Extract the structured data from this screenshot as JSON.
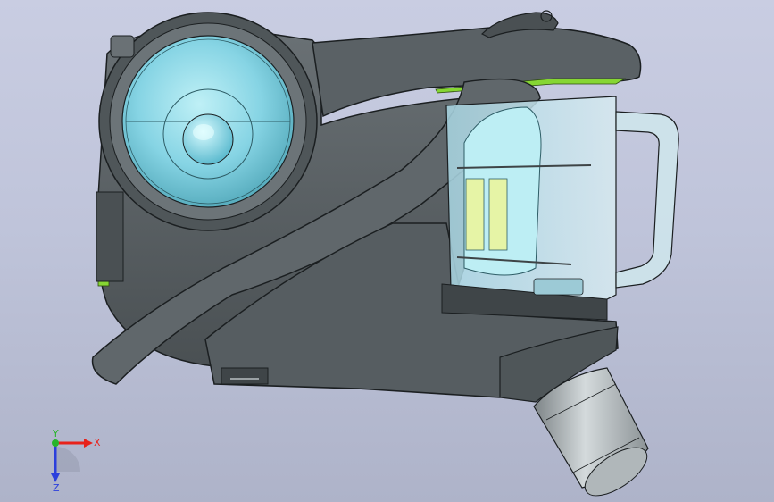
{
  "viewport": {
    "background_top": "#c9cde2",
    "background_bottom": "#aeb3c9"
  },
  "model": {
    "body_color": "#596064",
    "body_dark": "#3f4548",
    "edge_color": "#1b1f21",
    "bin_color": "#bfe0e8",
    "cyan_accent": "#7fd6e6",
    "green_accent": "#86d633",
    "pipe_color": "#b9c0c2"
  },
  "triad": {
    "x_label": "X",
    "y_label": "Y",
    "z_label": "Z",
    "x_color": "#e8221b",
    "y_color": "#28b52a",
    "z_color": "#2b3fdc"
  }
}
